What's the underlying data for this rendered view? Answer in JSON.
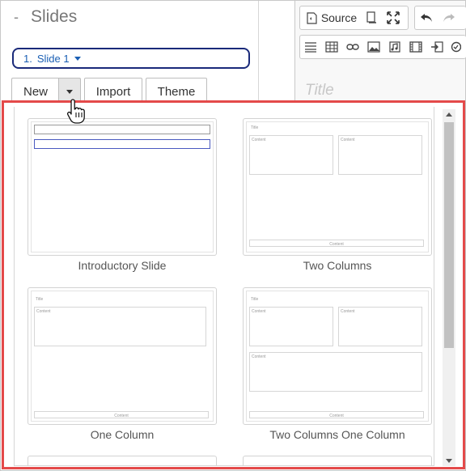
{
  "panel": {
    "title": "Slides",
    "collapse_symbol": "-",
    "slide_selector": {
      "number": "1.",
      "label": "Slide 1"
    }
  },
  "buttons": {
    "new": "New",
    "import": "Import",
    "theme": "Theme"
  },
  "toolbar": {
    "source_label": "Source",
    "title_placeholder": "Title",
    "icons": [
      "source-icon",
      "template-icon",
      "maximize-icon",
      "undo-icon",
      "redo-icon",
      "horizontal-rule-icon",
      "table-icon",
      "link-icon",
      "image-icon",
      "audio-icon",
      "video-icon",
      "insert-icon",
      "spellcheck-icon"
    ]
  },
  "layouts": [
    {
      "name": "Introductory Slide"
    },
    {
      "name": "Two Columns",
      "placeholders": {
        "title": "Title",
        "content": "Content"
      }
    },
    {
      "name": "One Column",
      "placeholders": {
        "title": "Title",
        "content": "Content"
      }
    },
    {
      "name": "Two Columns One Column",
      "placeholders": {
        "title": "Title",
        "content": "Content"
      }
    }
  ],
  "colors": {
    "highlight_border": "#e44a4a",
    "selector_border": "#1a2a7a",
    "link_blue": "#1a5fb4"
  }
}
